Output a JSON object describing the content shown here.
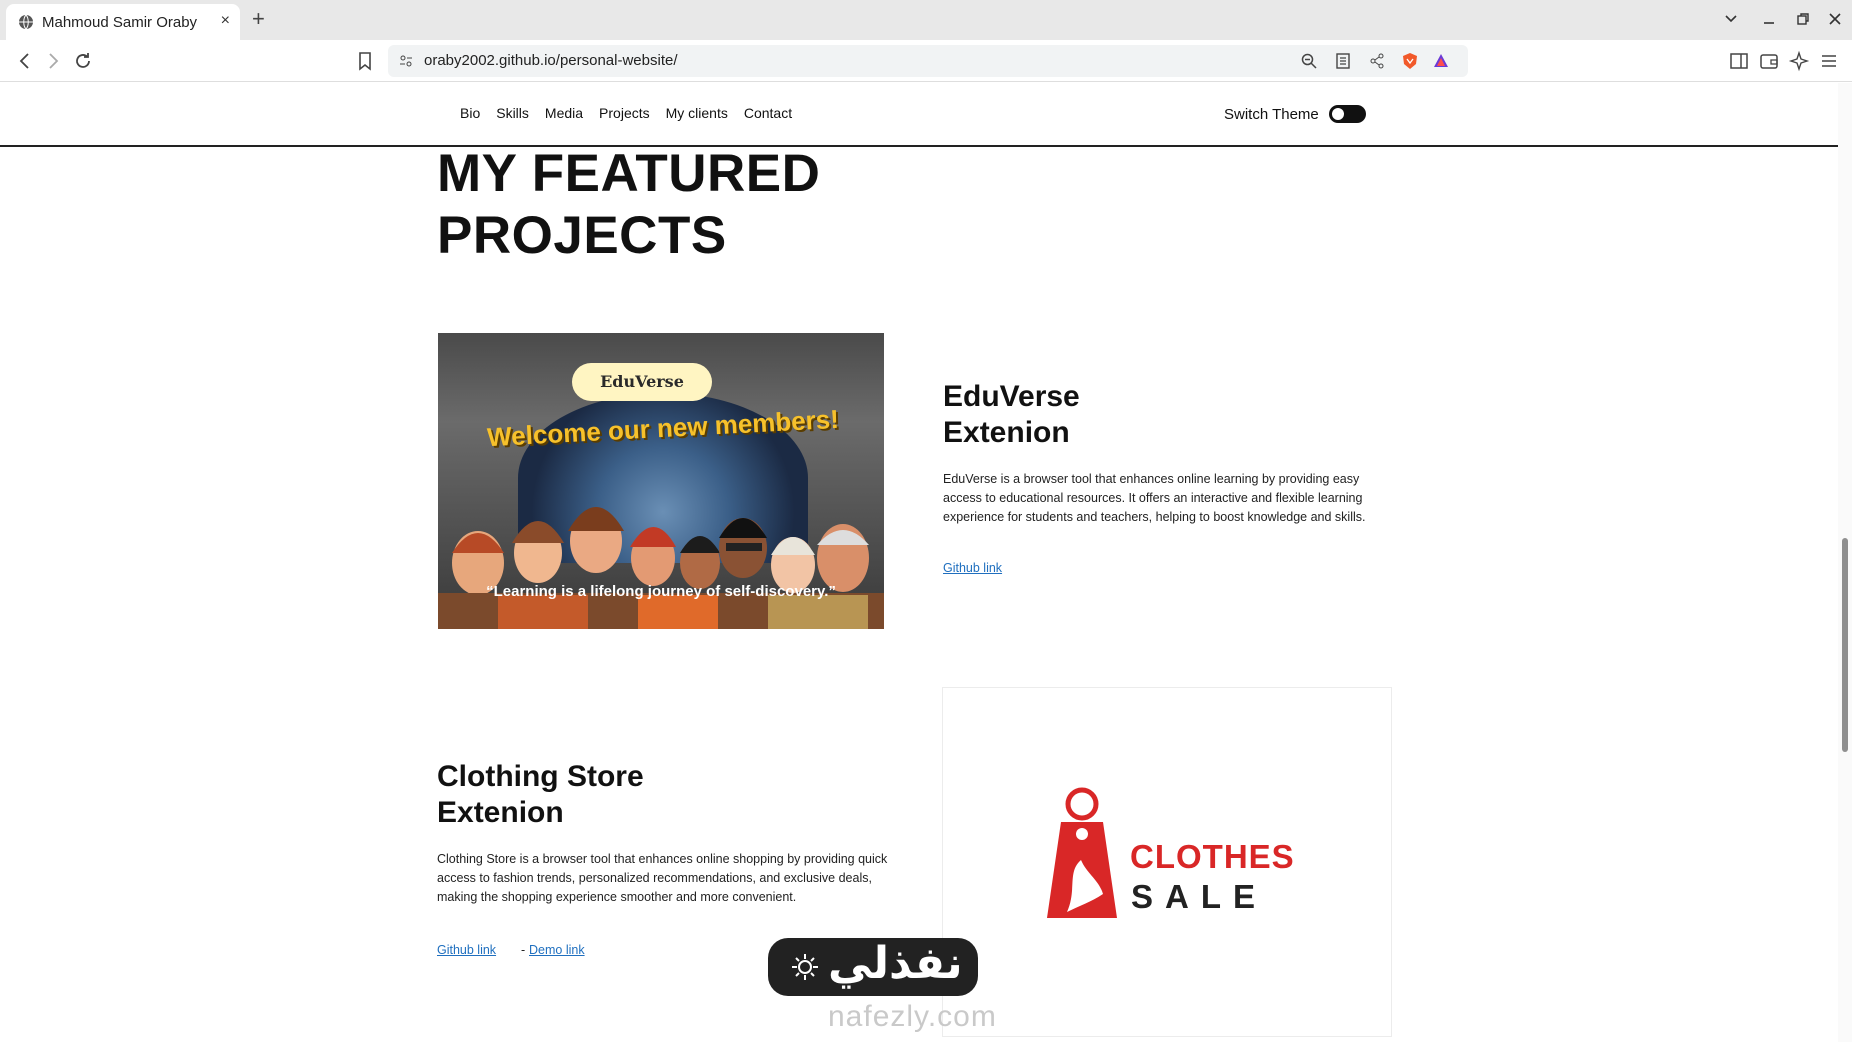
{
  "browser": {
    "tab_title": "Mahmoud Samir Oraby",
    "new_tab_label": "+",
    "tab_close_label": "×",
    "url": "oraby2002.github.io/personal-website/"
  },
  "nav": {
    "links": [
      "Bio",
      "Skills",
      "Media",
      "Projects",
      "My clients",
      "Contact"
    ],
    "switch_label": "Switch Theme"
  },
  "featured": {
    "title": "MY FEATURED\nPROJECTS"
  },
  "projects": [
    {
      "title": "EduVerse\nExtenion",
      "description": "EduVerse is a browser tool that enhances online learning by providing easy access to educational resources. It offers an interactive and flexible learning experience for students and teachers, helping to boost knowledge and skills.",
      "github_label": "Github link",
      "image": {
        "badge": "EduVerse",
        "headline": "Welcome our new members!",
        "quote": "“Learning is a lifelong journey of self-discovery.”"
      }
    },
    {
      "title": "Clothing Store\nExtenion",
      "description": "Clothing Store is a browser tool that enhances online shopping by providing quick access to fashion trends, personalized recommendations, and exclusive deals, making the shopping experience smoother and more convenient.",
      "github_label": "Github link",
      "separator": "-",
      "demo_label": "Demo link",
      "image": {
        "line1": "CLOTHES",
        "line2": "SALE"
      }
    }
  ],
  "watermark": {
    "arabic": "نفذلي",
    "domain": "nafezly.com"
  }
}
